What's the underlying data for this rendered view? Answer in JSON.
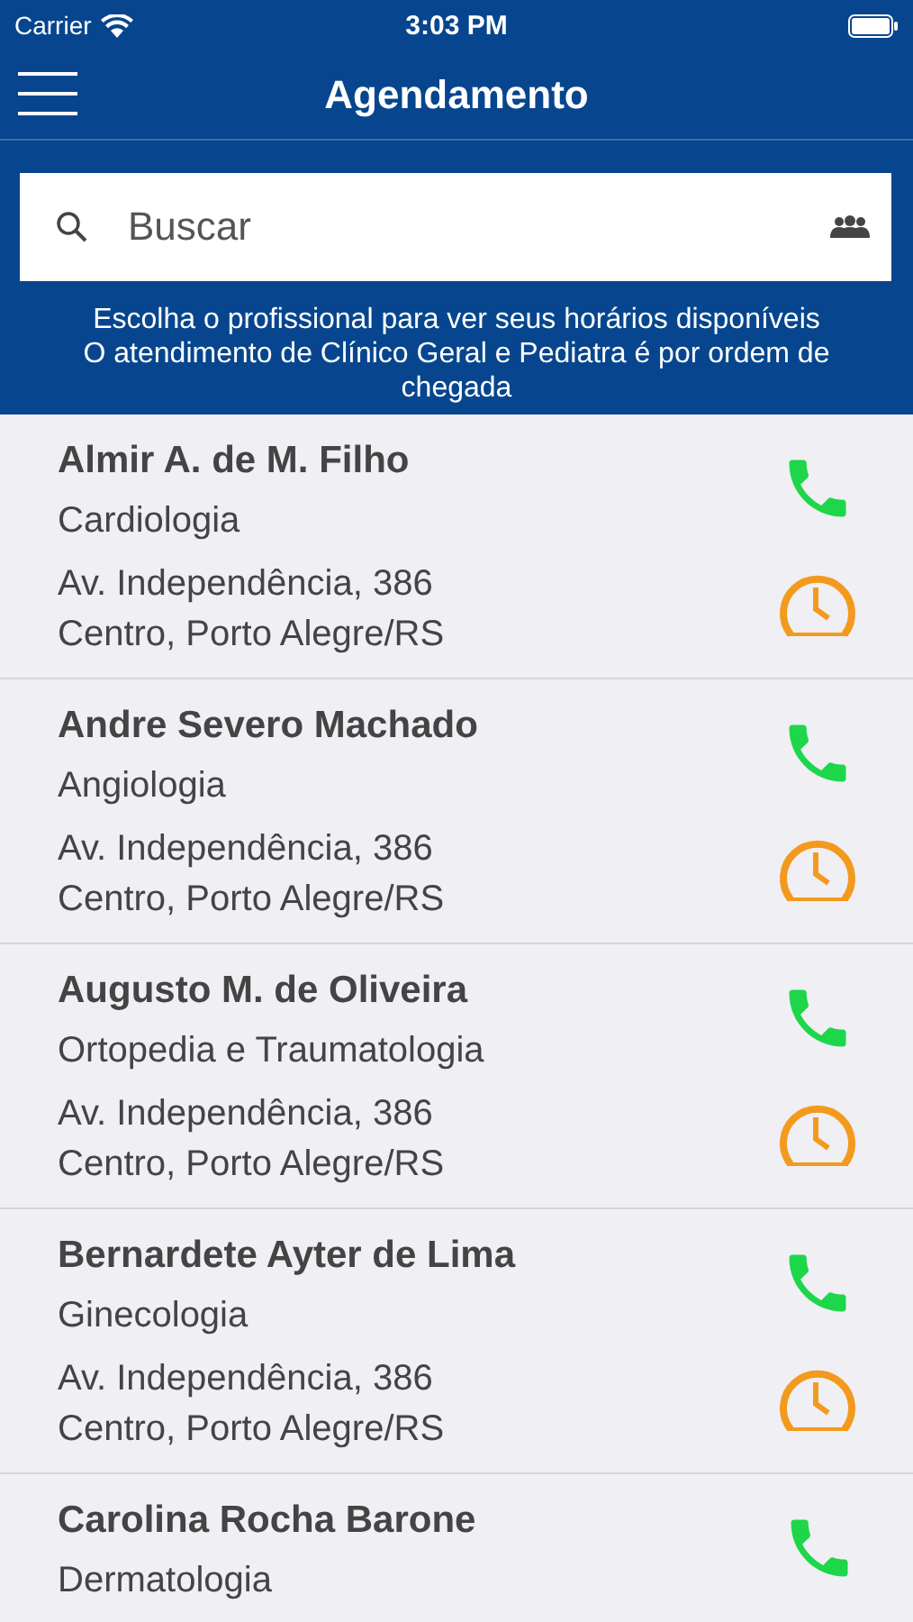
{
  "status_bar": {
    "carrier": "Carrier",
    "time": "3:03 PM"
  },
  "nav": {
    "title": "Agendamento"
  },
  "search": {
    "placeholder": "Buscar"
  },
  "notice": {
    "lines": [
      "Escolha o profissional para ver seus horários disponíveis",
      "O atendimento de Clínico Geral e Pediatra é por ordem de chegada"
    ]
  },
  "professionals": [
    {
      "name": "Almir A. de M. Filho",
      "specialty": "Cardiologia",
      "address": [
        "Av. Independência, 386",
        "Centro, Porto Alegre/RS"
      ]
    },
    {
      "name": "Andre Severo Machado",
      "specialty": "Angiologia",
      "address": [
        "Av. Independência, 386",
        "Centro, Porto Alegre/RS"
      ]
    },
    {
      "name": "Augusto M. de Oliveira",
      "specialty": "Ortopedia e Traumatologia",
      "address": [
        "Av. Independência, 386",
        "Centro, Porto Alegre/RS"
      ]
    },
    {
      "name": "Bernardete Ayter de Lima",
      "specialty": "Ginecologia",
      "address": [
        "Av. Independência, 386",
        "Centro, Porto Alegre/RS"
      ]
    },
    {
      "name": "Carolina Rocha Barone",
      "specialty": "Dermatologia"
    }
  ]
}
